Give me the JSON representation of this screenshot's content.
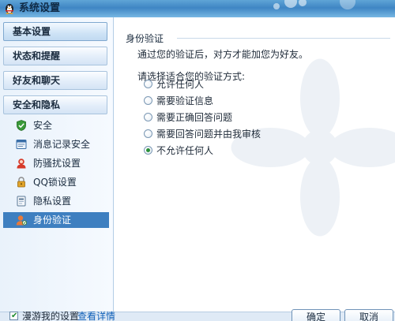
{
  "window": {
    "title": "系统设置"
  },
  "sidebar": {
    "categories": [
      {
        "label": "基本设置"
      },
      {
        "label": "状态和提醒"
      },
      {
        "label": "好友和聊天"
      },
      {
        "label": "安全和隐私"
      }
    ],
    "security_items": [
      {
        "label": "安全",
        "icon": "shield-icon"
      },
      {
        "label": "消息记录安全",
        "icon": "message-record-icon"
      },
      {
        "label": "防骚扰设置",
        "icon": "anti-harassment-icon"
      },
      {
        "label": "QQ锁设置",
        "icon": "lock-icon"
      },
      {
        "label": "隐私设置",
        "icon": "privacy-icon"
      },
      {
        "label": "身份验证",
        "icon": "identity-verification-icon",
        "selected": true
      }
    ]
  },
  "content": {
    "section_title": "身份验证",
    "description": "通过您的验证后，对方才能加您为好友。",
    "prompt": "请选择适合您的验证方式:",
    "options": [
      {
        "label": "允许任何人",
        "checked": false
      },
      {
        "label": "需要验证信息",
        "checked": false
      },
      {
        "label": "需要正确回答问题",
        "checked": false
      },
      {
        "label": "需要回答问题并由我审核",
        "checked": false
      },
      {
        "label": "不允许任何人",
        "checked": true
      }
    ]
  },
  "footer": {
    "roam_label": "漫游我的设置",
    "roam_checked": true,
    "details_link": "查看详情",
    "ok_label": "确定",
    "cancel_label": "取消"
  },
  "colors": {
    "accent": "#3e7fc0",
    "radio_dot": "#2a8f3a",
    "link": "#1060b8"
  }
}
